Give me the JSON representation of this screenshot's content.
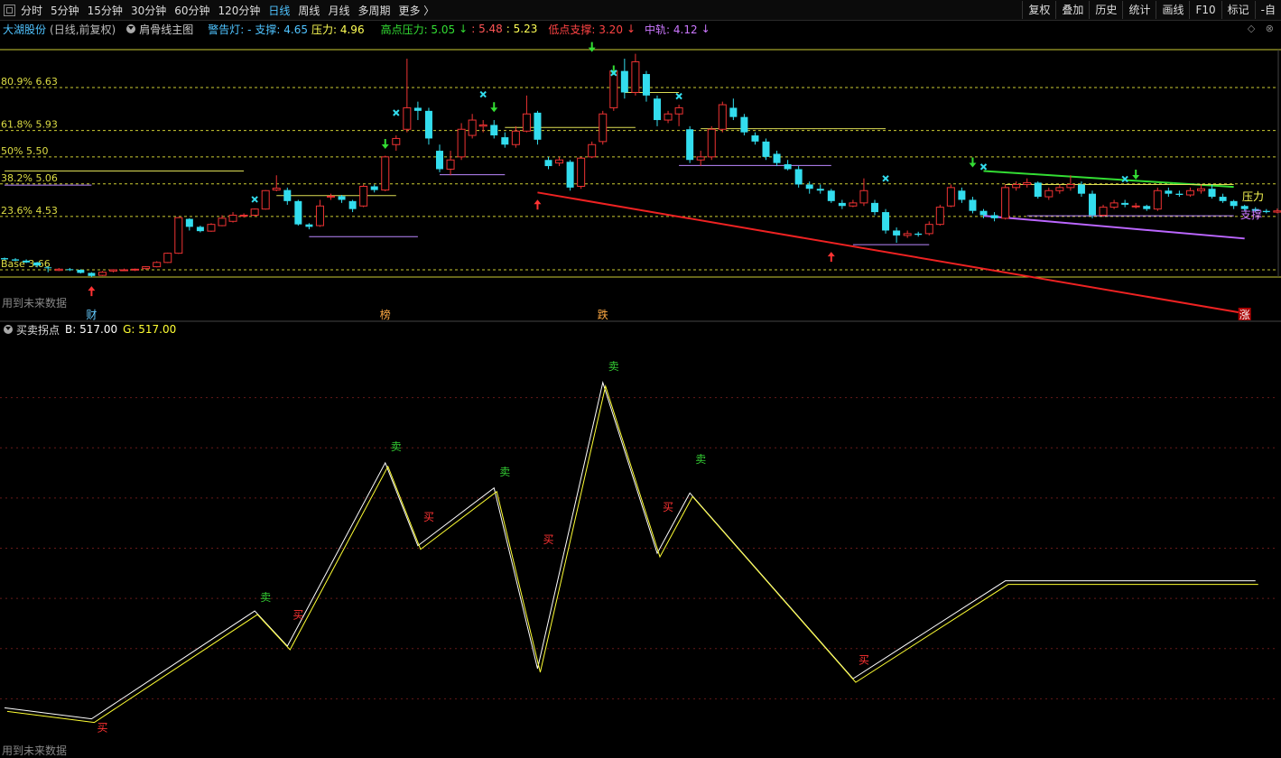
{
  "toolbar": {
    "periods": [
      "分时",
      "5分钟",
      "15分钟",
      "30分钟",
      "60分钟",
      "120分钟",
      "日线",
      "周线",
      "月线",
      "多周期",
      "更多 〉"
    ],
    "active_index": 6,
    "tools": [
      "复权",
      "叠加",
      "历史",
      "统计",
      "画线",
      "F10",
      "标记",
      "-自"
    ]
  },
  "info": {
    "stock": "大湖股份",
    "mode": "(日线,前复权)",
    "main_chart": "肩骨线主图",
    "warning_prefix": "警告灯: -",
    "support": "支撑: 4.65",
    "pressure": "压力: 4.96",
    "high_pressure": "高点压力: 5.05",
    "high_arrow": "↓",
    "val1": ": 5.48",
    "val2": ": 5.23",
    "low_support": "低点支撑: 3.20",
    "low_arrow": "↓",
    "mid_rail": "中轨: 4.12",
    "mid_arrow": "↓",
    "colors": {
      "stock": "#4fc3ff",
      "support": "#4fc3ff",
      "pressure": "#ffff55",
      "high": "#33dd33",
      "val1": "#ff5555",
      "val2": "#ffff55",
      "low": "#ff4444",
      "mid": "#cc77ff"
    }
  },
  "corner": {
    "icon1": "◇",
    "icon2": "⊗"
  },
  "fib": [
    {
      "label": "80.9% 6.63",
      "price": 6.63
    },
    {
      "label": "61.8% 5.93",
      "price": 5.93
    },
    {
      "label": "50% 5.50",
      "price": 5.5
    },
    {
      "label": "38.2% 5.06",
      "price": 5.06
    },
    {
      "label": "23.6% 4.53",
      "price": 4.53
    },
    {
      "label": "Base 3.66",
      "price": 3.66
    }
  ],
  "main_panel": {
    "future_note": "用到未来数据",
    "right_labels": {
      "pressure": "压力",
      "support": "支撑"
    },
    "event_markers": [
      {
        "text": "财",
        "index": 8,
        "color": "#66ccff"
      },
      {
        "text": "榜",
        "index": 35,
        "color": "#ffaa44"
      },
      {
        "text": "跌",
        "index": 55,
        "color": "#ffaa44"
      },
      {
        "text": "涨",
        "index": 114,
        "color": "#ffffff"
      }
    ]
  },
  "indicator": {
    "name": "买卖拐点",
    "b_label": "B: 517.00",
    "g_label": "G: 517.00",
    "future_note": "用到未来数据",
    "buy_text": "买",
    "sell_text": "卖",
    "line_white": "#ffffff",
    "line_yellow": "#ffff33",
    "buy_color": "#ff3333",
    "sell_color": "#33cc33"
  },
  "candles": [
    [
      3.85,
      3.83,
      3.86,
      3.82
    ],
    [
      3.83,
      3.81,
      3.85,
      3.8
    ],
    [
      3.81,
      3.78,
      3.83,
      3.77
    ],
    [
      3.78,
      3.73,
      3.79,
      3.7
    ],
    [
      3.7,
      3.69,
      3.72,
      3.62
    ],
    [
      3.65,
      3.67,
      3.69,
      3.64
    ],
    [
      3.67,
      3.66,
      3.69,
      3.64
    ],
    [
      3.66,
      3.61,
      3.67,
      3.6
    ],
    [
      3.61,
      3.56,
      3.62,
      3.54
    ],
    [
      3.57,
      3.62,
      3.64,
      3.56
    ],
    [
      3.64,
      3.66,
      3.67,
      3.62
    ],
    [
      3.66,
      3.66,
      3.68,
      3.65
    ],
    [
      3.66,
      3.67,
      3.68,
      3.64
    ],
    [
      3.68,
      3.71,
      3.72,
      3.66
    ],
    [
      3.71,
      3.78,
      3.8,
      3.7
    ],
    [
      3.78,
      3.93,
      3.94,
      3.77
    ],
    [
      3.93,
      4.51,
      4.52,
      3.92
    ],
    [
      4.49,
      4.36,
      4.5,
      4.3
    ],
    [
      4.36,
      4.29,
      4.38,
      4.27
    ],
    [
      4.29,
      4.4,
      4.42,
      4.28
    ],
    [
      4.38,
      4.5,
      4.55,
      4.37
    ],
    [
      4.45,
      4.55,
      4.6,
      4.43
    ],
    [
      4.55,
      4.55,
      4.58,
      4.51
    ],
    [
      4.55,
      4.65,
      4.66,
      4.53
    ],
    [
      4.65,
      4.95,
      4.96,
      4.64
    ],
    [
      4.96,
      4.99,
      5.2,
      4.94
    ],
    [
      4.96,
      4.78,
      5.0,
      4.72
    ],
    [
      4.78,
      4.4,
      4.8,
      4.38
    ],
    [
      4.4,
      4.36,
      4.42,
      4.32
    ],
    [
      4.38,
      4.7,
      4.8,
      4.36
    ],
    [
      4.85,
      4.86,
      4.9,
      4.8
    ],
    [
      4.86,
      4.8,
      4.88,
      4.75
    ],
    [
      4.78,
      4.65,
      4.8,
      4.6
    ],
    [
      4.7,
      5.02,
      5.05,
      4.68
    ],
    [
      5.02,
      4.96,
      5.05,
      4.92
    ],
    [
      4.96,
      5.5,
      5.52,
      4.94
    ],
    [
      5.7,
      5.8,
      5.85,
      5.6
    ],
    [
      5.95,
      6.3,
      7.1,
      5.9
    ],
    [
      6.3,
      6.25,
      6.4,
      6.1
    ],
    [
      6.25,
      5.8,
      6.3,
      5.7
    ],
    [
      5.6,
      5.3,
      5.7,
      5.25
    ],
    [
      5.3,
      5.45,
      5.6,
      5.2
    ],
    [
      5.5,
      5.95,
      6.05,
      5.45
    ],
    [
      5.85,
      6.1,
      6.2,
      5.8
    ],
    [
      6.0,
      6.02,
      6.1,
      5.9
    ],
    [
      6.02,
      5.85,
      6.1,
      5.8
    ],
    [
      5.82,
      5.7,
      5.9,
      5.65
    ],
    [
      5.7,
      5.92,
      6.0,
      5.65
    ],
    [
      5.92,
      6.2,
      6.5,
      5.9
    ],
    [
      6.22,
      5.78,
      6.25,
      5.7
    ],
    [
      5.45,
      5.35,
      5.5,
      5.3
    ],
    [
      5.4,
      5.45,
      5.5,
      5.35
    ],
    [
      5.42,
      5.0,
      5.45,
      4.95
    ],
    [
      5.02,
      5.48,
      5.5,
      4.98
    ],
    [
      5.5,
      5.7,
      5.75,
      5.48
    ],
    [
      5.75,
      6.2,
      6.25,
      5.7
    ],
    [
      6.3,
      6.9,
      6.95,
      6.25
    ],
    [
      6.9,
      6.55,
      7.1,
      6.45
    ],
    [
      6.55,
      7.05,
      7.18,
      6.5
    ],
    [
      6.85,
      6.5,
      6.9,
      6.4
    ],
    [
      6.45,
      6.1,
      6.5,
      6.0
    ],
    [
      6.1,
      6.2,
      6.25,
      6.05
    ],
    [
      6.2,
      6.3,
      6.35,
      6.0
    ],
    [
      5.95,
      5.45,
      6.0,
      5.4
    ],
    [
      5.45,
      5.5,
      5.6,
      5.35
    ],
    [
      5.5,
      5.95,
      6.0,
      5.45
    ],
    [
      5.95,
      6.35,
      6.4,
      5.9
    ],
    [
      6.3,
      6.15,
      6.45,
      6.1
    ],
    [
      6.15,
      5.9,
      6.2,
      5.85
    ],
    [
      5.85,
      5.75,
      5.9,
      5.7
    ],
    [
      5.75,
      5.5,
      5.8,
      5.45
    ],
    [
      5.55,
      5.4,
      5.6,
      5.35
    ],
    [
      5.38,
      5.3,
      5.45,
      5.28
    ],
    [
      5.3,
      5.05,
      5.35,
      5.0
    ],
    [
      5.05,
      4.98,
      5.1,
      4.9
    ],
    [
      4.98,
      4.95,
      5.05,
      4.9
    ],
    [
      4.95,
      4.78,
      4.98,
      4.75
    ],
    [
      4.75,
      4.7,
      4.8,
      4.65
    ],
    [
      4.7,
      4.75,
      4.8,
      4.68
    ],
    [
      4.75,
      4.95,
      5.15,
      4.7
    ],
    [
      4.75,
      4.6,
      4.8,
      4.55
    ],
    [
      4.6,
      4.3,
      4.65,
      4.25
    ],
    [
      4.3,
      4.22,
      4.35,
      4.1
    ],
    [
      4.22,
      4.25,
      4.3,
      4.18
    ],
    [
      4.25,
      4.23,
      4.28,
      4.2
    ],
    [
      4.25,
      4.4,
      4.45,
      4.22
    ],
    [
      4.4,
      4.68,
      4.72,
      4.38
    ],
    [
      4.7,
      5.0,
      5.05,
      4.68
    ],
    [
      4.95,
      4.8,
      5.0,
      4.75
    ],
    [
      4.8,
      4.62,
      4.85,
      4.58
    ],
    [
      4.62,
      4.55,
      4.65,
      4.5
    ],
    [
      4.55,
      4.5,
      4.6,
      4.45
    ],
    [
      4.5,
      5.0,
      5.05,
      4.48
    ],
    [
      5.0,
      5.05,
      5.1,
      4.95
    ],
    [
      5.05,
      5.08,
      5.15,
      5.0
    ],
    [
      5.08,
      4.85,
      5.1,
      4.82
    ],
    [
      4.85,
      4.95,
      5.0,
      4.8
    ],
    [
      4.95,
      5.0,
      5.05,
      4.9
    ],
    [
      5.0,
      5.05,
      5.2,
      4.95
    ],
    [
      5.05,
      4.9,
      5.1,
      4.85
    ],
    [
      4.9,
      4.55,
      4.95,
      4.5
    ],
    [
      4.55,
      4.68,
      4.72,
      4.52
    ],
    [
      4.68,
      4.75,
      4.8,
      4.65
    ],
    [
      4.75,
      4.72,
      4.8,
      4.68
    ],
    [
      4.7,
      4.7,
      4.75,
      4.66
    ],
    [
      4.7,
      4.65,
      4.72,
      4.62
    ],
    [
      4.65,
      4.95,
      5.0,
      4.62
    ],
    [
      4.95,
      4.9,
      5.0,
      4.85
    ],
    [
      4.9,
      4.88,
      4.95,
      4.85
    ],
    [
      4.88,
      4.95,
      5.0,
      4.85
    ],
    [
      4.95,
      4.98,
      5.05,
      4.9
    ],
    [
      4.98,
      4.85,
      5.05,
      4.82
    ],
    [
      4.85,
      4.78,
      4.9,
      4.75
    ],
    [
      4.78,
      4.7,
      4.8,
      4.65
    ],
    [
      4.7,
      4.65,
      4.72,
      4.62
    ],
    [
      4.65,
      4.62,
      4.68,
      4.6
    ],
    [
      4.62,
      4.6,
      4.65,
      4.58
    ],
    [
      4.6,
      4.62,
      4.66,
      4.58
    ],
    [
      4.62,
      4.66,
      4.7,
      4.6
    ],
    [
      4.66,
      4.6,
      4.68,
      4.58
    ],
    [
      4.6,
      4.65,
      5.05,
      4.55
    ]
  ],
  "indicator_line": [
    [
      0,
      0.82
    ],
    [
      8,
      0.6
    ],
    [
      23,
      2.75
    ],
    [
      26,
      2.05
    ],
    [
      35,
      5.7
    ],
    [
      38,
      4.05
    ],
    [
      45,
      5.2
    ],
    [
      49,
      1.6
    ],
    [
      55,
      7.3
    ],
    [
      60,
      3.9
    ],
    [
      63,
      5.1
    ],
    [
      78,
      1.4
    ],
    [
      92,
      3.35
    ],
    [
      115,
      3.35
    ]
  ],
  "indicator_signals": [
    {
      "type": "buy",
      "index": 9,
      "value": 0.35
    },
    {
      "type": "sell",
      "index": 24,
      "value": 2.95
    },
    {
      "type": "buy",
      "index": 27,
      "value": 2.6
    },
    {
      "type": "sell",
      "index": 36,
      "value": 5.95
    },
    {
      "type": "buy",
      "index": 39,
      "value": 4.55
    },
    {
      "type": "sell",
      "index": 46,
      "value": 5.45
    },
    {
      "type": "buy",
      "index": 50,
      "value": 4.1
    },
    {
      "type": "sell",
      "index": 56,
      "value": 7.55
    },
    {
      "type": "buy",
      "index": 61,
      "value": 4.75
    },
    {
      "type": "sell",
      "index": 64,
      "value": 5.7
    },
    {
      "type": "buy",
      "index": 79,
      "value": 1.7
    }
  ]
}
